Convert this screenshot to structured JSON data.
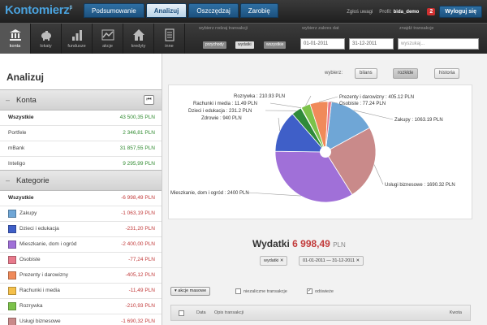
{
  "app": {
    "logo": "Kontomierz",
    "logo_sup": "β"
  },
  "topnav": [
    {
      "label": "Podsumowanie",
      "active": false
    },
    {
      "label": "Analizuj",
      "active": true
    },
    {
      "label": "Oszczędzaj",
      "active": false
    },
    {
      "label": "Zarobię",
      "active": false
    }
  ],
  "user": {
    "welcome": "Zgłoś uwagi",
    "profile": "Profil:",
    "name": "bida_demo",
    "badge": "2",
    "logout": "Wyloguj się"
  },
  "toolbar": {
    "tools": [
      {
        "label": "konta",
        "icon": "bank-icon",
        "active": true
      },
      {
        "label": "lokaty",
        "icon": "piggy-bank-icon",
        "active": false
      },
      {
        "label": "fundusze",
        "icon": "bar-chart-icon",
        "active": false
      },
      {
        "label": "akcje",
        "icon": "line-chart-icon",
        "active": false
      },
      {
        "label": "kredyty",
        "icon": "house-icon",
        "active": false
      },
      {
        "label": "inne",
        "icon": "document-icon",
        "active": false
      }
    ],
    "filter_type_label": "wybierz rodzaj transakcji",
    "types": [
      "przychody",
      "wydatki",
      "wszystkie"
    ],
    "date_label": "wybierz zakres dat",
    "date_from": "01-01-2011",
    "date_to": "31-12-2011",
    "search_label": "znajdź transakcje",
    "search_placeholder": "wyszukaj..."
  },
  "left": {
    "title": "Analizuj",
    "konta_header": "Konta",
    "accounts": [
      {
        "name": "Wszystkie",
        "value": "43 500,35 PLN",
        "bold": true
      },
      {
        "name": "Portfele",
        "value": "2 346,81 PLN",
        "bold": false
      },
      {
        "name": "mBank",
        "value": "31 857,55 PLN",
        "bold": false
      },
      {
        "name": "Inteligo",
        "value": "9 295,99 PLN",
        "bold": false
      }
    ],
    "kategorie_header": "Kategorie",
    "categories": [
      {
        "name": "Wszystkie",
        "value": "-6 998,49 PLN",
        "bold": true,
        "color": ""
      },
      {
        "name": "Zakupy",
        "value": "-1 063,19 PLN",
        "bold": false,
        "color": "#6fa6d6"
      },
      {
        "name": "Dzieci i edukacja",
        "value": "-231,20 PLN",
        "bold": false,
        "color": "#3f5fc8"
      },
      {
        "name": "Mieszkanie, dom i ogród",
        "value": "-2 400,00 PLN",
        "bold": false,
        "color": "#a070d8"
      },
      {
        "name": "Osobiste",
        "value": "-77,24 PLN",
        "bold": false,
        "color": "#e87a8c"
      },
      {
        "name": "Prezenty i darowizny",
        "value": "-405,12 PLN",
        "bold": false,
        "color": "#f08a5a"
      },
      {
        "name": "Rachunki i media",
        "value": "-11,49 PLN",
        "bold": false,
        "color": "#f5c04a"
      },
      {
        "name": "Rozrywka",
        "value": "-210,93 PLN",
        "bold": false,
        "color": "#7cc24a"
      },
      {
        "name": "Usługi biznesowe",
        "value": "-1 690,32 PLN",
        "bold": false,
        "color": "#c98a8a"
      }
    ]
  },
  "view": {
    "label": "wybierz:",
    "buttons": [
      "bilans",
      "rozkłde",
      "historia"
    ]
  },
  "chart_data": {
    "type": "pie",
    "title": "",
    "unit": "PLN",
    "slices": [
      {
        "label": "Zakupy",
        "value": 1063.19,
        "text": "Zakupy : 1063.19 PLN",
        "color": "#6fa6d6"
      },
      {
        "label": "Usługi biznesowe",
        "value": 1690.32,
        "text": "Usługi biznesowe : 1690.32 PLN",
        "color": "#c98a8a"
      },
      {
        "label": "Mieszkanie, dom i ogród",
        "value": 2400,
        "text": "Mieszkanie, dom i ogród : 2400 PLN",
        "color": "#a070d8"
      },
      {
        "label": "Zdrowie",
        "value": 940,
        "text": "Zdrowie : 940 PLN",
        "color": "#3f5fc8"
      },
      {
        "label": "Dzieci i edukacja",
        "value": 231.2,
        "text": "Dzieci i edukacja : 231.2 PLN",
        "color": "#2f8a3a"
      },
      {
        "label": "Rachunki i media",
        "value": 11.49,
        "text": "Rachunki i media : 11.49 PLN",
        "color": "#f5c04a"
      },
      {
        "label": "Rozrywka",
        "value": 210.93,
        "text": "Rozrywka : 210.93 PLN",
        "color": "#7cc24a"
      },
      {
        "label": "Prezenty i darowizny",
        "value": 405.12,
        "text": "Prezenty i darowizny : 405.12 PLN",
        "color": "#f08a5a"
      },
      {
        "label": "Osobiste",
        "value": 77.24,
        "text": "Osobiste : 77.24 PLN",
        "color": "#e87a8c"
      }
    ]
  },
  "summary": {
    "label": "Wydatki",
    "amount": "6 998,49",
    "currency": "PLN"
  },
  "tags": [
    "wydatki ✕",
    "01-01-2011 — 31-12-2011 ✕"
  ],
  "actions": {
    "button": "▾  akcje masowe",
    "opt1": "niezaliczne transakcje",
    "opt2": "odświeże"
  },
  "table": {
    "col_date": "Data",
    "col_desc": "Opis transakcji",
    "col_amount": "Kwota"
  }
}
